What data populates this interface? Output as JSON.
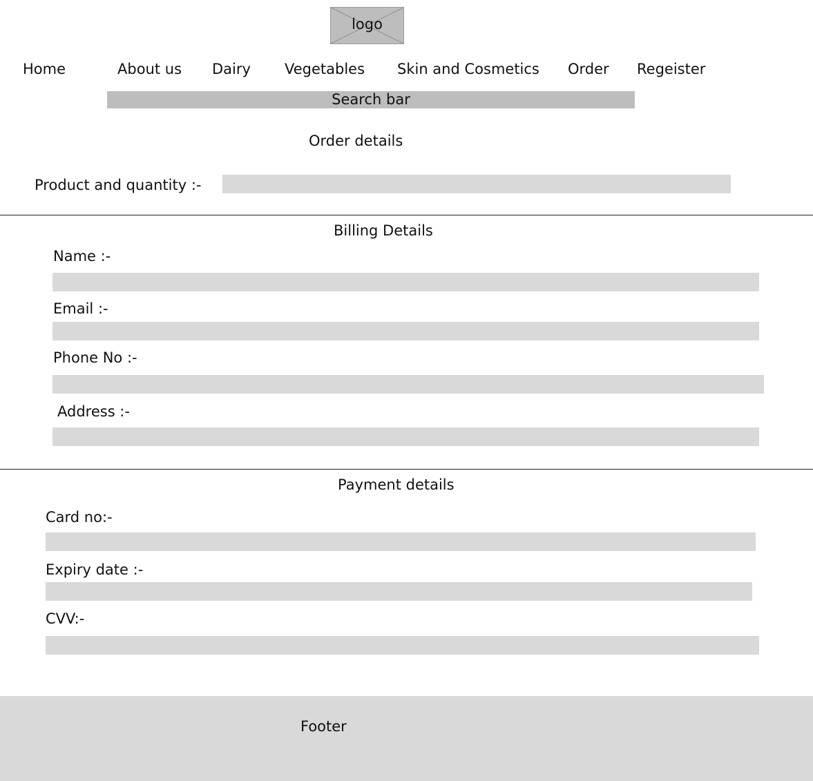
{
  "header": {
    "logo_text": "logo"
  },
  "nav": {
    "items": [
      {
        "label": "Home"
      },
      {
        "label": "About us"
      },
      {
        "label": "Dairy"
      },
      {
        "label": "Vegetables"
      },
      {
        "label": "Skin and Cosmetics"
      },
      {
        "label": "Order"
      },
      {
        "label": "Regeister"
      }
    ]
  },
  "search": {
    "placeholder": "Search bar"
  },
  "order": {
    "title": "Order details",
    "product_label": "Product and quantity :-"
  },
  "billing": {
    "title": "Billing Details",
    "name_label": "Name :-",
    "email_label": "Email :-",
    "phone_label": "Phone No :-",
    "address_label": "Address :-"
  },
  "payment": {
    "title": "Payment details",
    "card_label": "Card no:-",
    "expiry_label": "Expiry date :-",
    "cvv_label": "CVV:-"
  },
  "footer": {
    "text": "Footer"
  }
}
